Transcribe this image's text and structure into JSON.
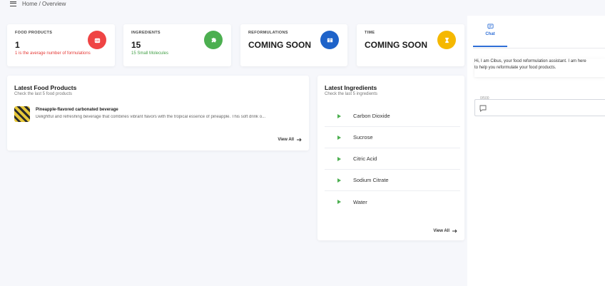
{
  "breadcrumb": "Home / Overview",
  "stats": [
    {
      "label": "FOOD PRODUCTS",
      "value": "1",
      "note": "1 is the average number of formulations",
      "note_color": "#e53935",
      "icon": "bread-icon",
      "color": "#ef4444"
    },
    {
      "label": "INGREDIENTS",
      "value": "15",
      "note": "15 Small Molecules",
      "note_color": "#43a047",
      "icon": "puzzle-icon",
      "color": "#4caf50"
    },
    {
      "label": "REFORMULATIONS",
      "value": "COMING SOON",
      "note": "",
      "icon": "book-icon",
      "color": "#1e63c9"
    },
    {
      "label": "TIME",
      "value": "COMING SOON",
      "note": "",
      "icon": "hourglass-icon",
      "color": "#f5b800"
    }
  ],
  "latest_products": {
    "title": "Latest Food Products",
    "subtitle": "Check the last 5 food products",
    "items": [
      {
        "name": "Pineapple-flavored carbonated beverage",
        "description": "Delightful and refreshing beverage that combines vibrant flavors with the tropical essence of pineapple. This soft drink o..."
      }
    ],
    "view_all": "View All"
  },
  "latest_ingredients": {
    "title": "Latest Ingredients",
    "subtitle": "Check the last 5 ingredients",
    "items": [
      "Carbon Dioxide",
      "Sucrose",
      "Citric Acid",
      "Sodium Citrate",
      "Water"
    ],
    "view_all": "View All"
  },
  "chat": {
    "tab_label": "Chat",
    "message_line1": "Hi, I am Cibus, your food reformulation assistant. I am here",
    "message_line2": "to help you reformulate your food products.",
    "counter": "0/500"
  }
}
